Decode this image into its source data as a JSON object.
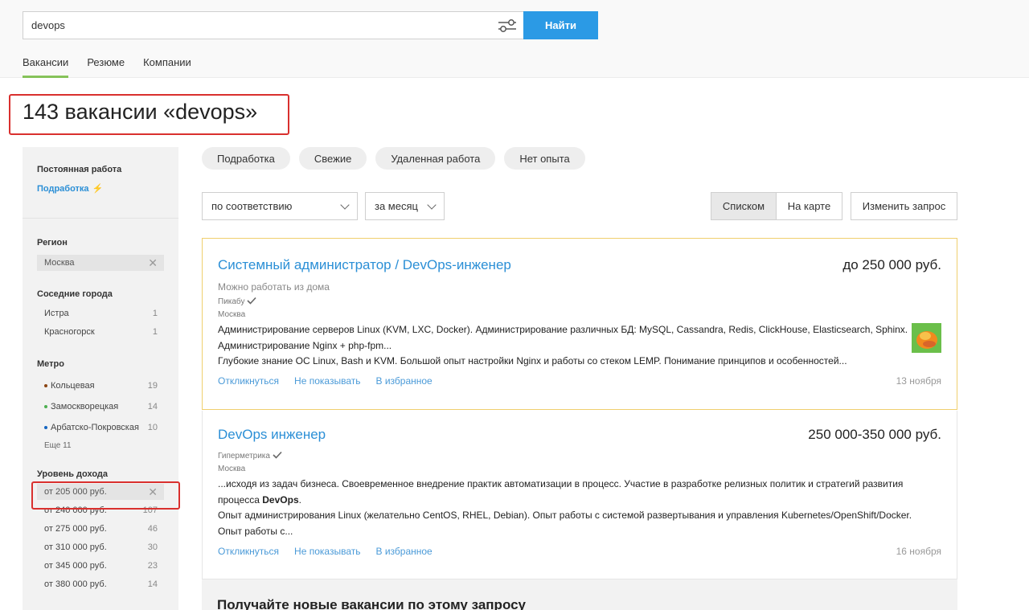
{
  "search": {
    "query": "devops",
    "button": "Найти",
    "filter_icon": "sliders-icon"
  },
  "tabs": [
    {
      "label": "Вакансии",
      "active": true
    },
    {
      "label": "Резюме"
    },
    {
      "label": "Компании"
    }
  ],
  "page_title": "143 вакансии «devops»",
  "sidebar": {
    "employment": {
      "title": "Постоянная работа",
      "link": "Подработка",
      "link_icon": "⚡"
    },
    "region": {
      "title": "Регион",
      "selected": "Москва"
    },
    "nearby": {
      "title": "Соседние города",
      "items": [
        {
          "label": "Истра",
          "count": "1"
        },
        {
          "label": "Красногорск",
          "count": "1"
        }
      ]
    },
    "metro": {
      "title": "Метро",
      "items": [
        {
          "label": "Кольцевая",
          "count": "19",
          "color": "#8b4513"
        },
        {
          "label": "Замоскворецкая",
          "count": "14",
          "color": "#4caf50"
        },
        {
          "label": "Арбатско-Покровская",
          "count": "10",
          "color": "#1565c0"
        }
      ],
      "more": "Еще 11"
    },
    "income": {
      "title": "Уровень дохода",
      "selected": "от 205 000 руб.",
      "items": [
        {
          "label": "от 240 000 руб.",
          "count": "107"
        },
        {
          "label": "от 275 000 руб.",
          "count": "46"
        },
        {
          "label": "от 310 000 руб.",
          "count": "30"
        },
        {
          "label": "от 345 000 руб.",
          "count": "23"
        },
        {
          "label": "от 380 000 руб.",
          "count": "14"
        }
      ]
    }
  },
  "quick_filters": [
    "Подработка",
    "Свежие",
    "Удаленная работа",
    "Нет опыта"
  ],
  "sort": {
    "order": "по соответствию",
    "period": "за месяц"
  },
  "view": {
    "list": "Списком",
    "map": "На карте"
  },
  "change_query": "Изменить запрос",
  "vacancies": [
    {
      "title": "Системный администратор / DevOps-инженер",
      "salary": "до 250 000 руб.",
      "remote": "Можно работать из дома",
      "company": "Пикабу",
      "city": "Москва",
      "text1": "Администрирование серверов Linux (KVM, LXC, Docker). Администрирование различных БД: MySQL, Cassandra, Redis, ClickHouse, Elasticsearch, Sphinx. Администрирование Nginx + php-fpm...",
      "text2": "Глубокие знание ОС Linux, Bash и KVM. Большой опыт настройки Nginx и работы со стеком LEMP. Понимание принципов и особенностей...",
      "date": "13 ноября"
    },
    {
      "title": "DevOps инженер",
      "salary": "250 000-350 000 руб.",
      "company": "Гиперметрика",
      "city": "Москва",
      "text1_pre": "...исходя из задач бизнеса. Своевременное внедрение практик автоматизации в процесс. Участие в разработке релизных политик и стратегий развития процесса ",
      "text1_bold": "DevOps",
      "text1_post": ".",
      "text2": "Опыт администрирования Linux (желательно CentOS, RHEL, Debian). Опыт работы с системой развертывания и управления Kubernetes/OpenShift/Docker. Опыт работы с...",
      "date": "16 ноября"
    }
  ],
  "actions": {
    "respond": "Откликнуться",
    "hide": "Не показывать",
    "favorite": "В избранное"
  },
  "subscribe_title": "Получайте новые вакансии по этому запросу",
  "colors": {
    "accent": "#2b9ae5",
    "link": "#2b8fd6",
    "highlight": "#d9302e",
    "tab_underline": "#86c35a"
  }
}
